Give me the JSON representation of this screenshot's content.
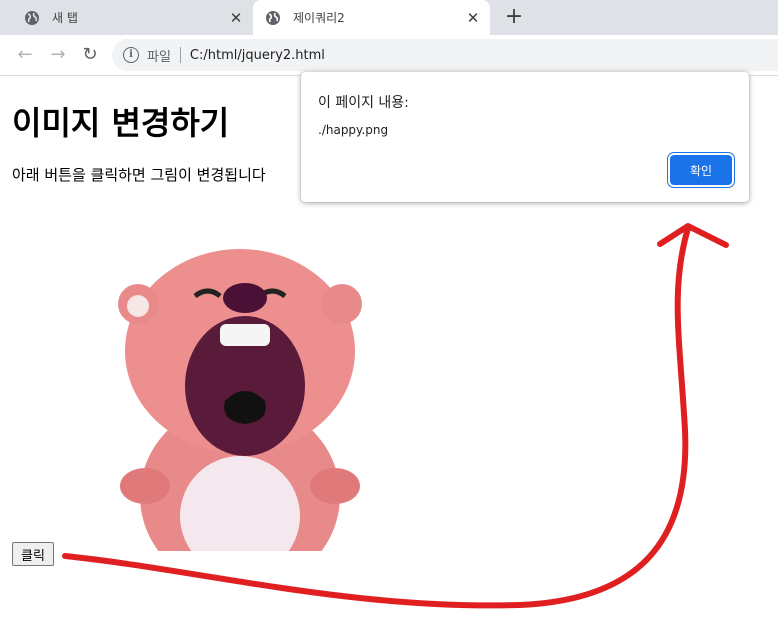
{
  "browser": {
    "tabs": [
      {
        "title": "새 탭",
        "icon": "globe-icon"
      },
      {
        "title": "제이쿼리2",
        "icon": "globe-icon",
        "active": true
      }
    ],
    "address": {
      "scheme_label": "파일",
      "url": "C:/html/jquery2.html"
    }
  },
  "page": {
    "heading": "이미지 변경하기",
    "description": "아래 버튼을 클릭하면 그림이 변경됩니다",
    "button_label": "클릭",
    "image": "loopy-character-crying"
  },
  "dialog": {
    "title": "이 페이지 내용:",
    "message": "./happy.png",
    "ok_label": "확인"
  },
  "annotation": {
    "color": "#e02020",
    "shape": "arrow-from-button-to-dialog"
  }
}
